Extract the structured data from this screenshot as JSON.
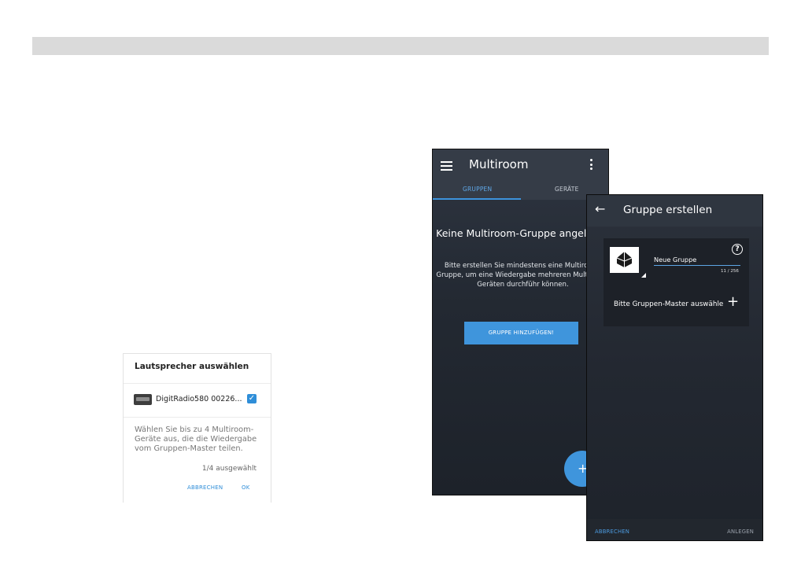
{
  "dialog": {
    "title": "Lautsprecher auswählen",
    "device_name": "DigitRadio580 00226...",
    "device_checked": true,
    "check_glyph": "✓",
    "description": "Wählen Sie bis zu 4 Multiroom-Geräte aus, die die Wiedergabe vom Gruppen-Master teilen.",
    "selection_count": "1/4 ausgewählt",
    "cancel_label": "ABBRECHEN",
    "ok_label": "OK"
  },
  "multiroom": {
    "title": "Multiroom",
    "tabs": [
      {
        "label": "GRUPPEN",
        "active": true
      },
      {
        "label": "GERÄTE",
        "active": false
      }
    ],
    "empty_title": "Keine Multiroom-Gruppe angelegt!",
    "empty_description": "Bitte erstellen Sie mindestens eine Multiroom-Gruppe, um eine Wiedergabe mehreren Multiroom-Geräten durchführ können.",
    "add_group_label": "GRUPPE HINZUFÜGEN!",
    "fab_glyph": "+"
  },
  "create_group": {
    "back_glyph": "←",
    "title": "Gruppe erstellen",
    "help_glyph": "?",
    "group_name": "Neue Gruppe",
    "char_counter": "11 / 256",
    "master_prompt": "Bitte Gruppen-Master auswähle",
    "plus_glyph": "+",
    "cancel_label": "ABBRECHEN",
    "create_label": "ANLEGEN"
  },
  "colors": {
    "accent": "#3f95dc",
    "dark_bg": "#232932",
    "header_bg": "#353c47"
  }
}
